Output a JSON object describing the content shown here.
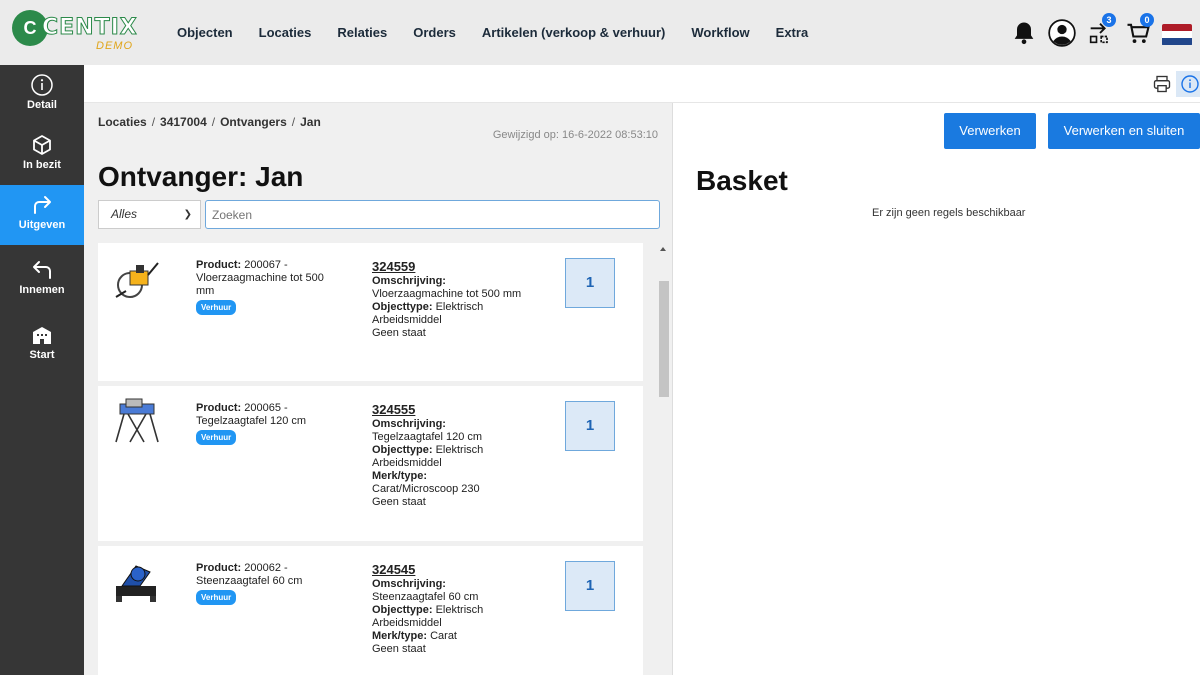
{
  "brand": {
    "name": "CENTIX",
    "sub": "DEMO"
  },
  "nav": [
    "Objecten",
    "Locaties",
    "Relaties",
    "Orders",
    "Artikelen (verkoop & verhuur)",
    "Workflow",
    "Extra"
  ],
  "badges": {
    "transfer": "3",
    "cart": "0"
  },
  "sidebar": [
    {
      "label": "Detail",
      "icon": "info-icon",
      "active": false
    },
    {
      "label": "In bezit",
      "icon": "cube-icon",
      "active": false
    },
    {
      "label": "Uitgeven",
      "icon": "arrow-out-icon",
      "active": true
    },
    {
      "label": "Innemen",
      "icon": "arrow-back-icon",
      "active": false
    },
    {
      "label": "Start",
      "icon": "building-icon",
      "active": false
    }
  ],
  "breadcrumb": [
    "Locaties",
    "3417004",
    "Ontvangers",
    "Jan"
  ],
  "modified": "Gewijzigd op: 16-6-2022 08:53:10",
  "title": "Ontvanger: Jan",
  "filter": {
    "selected": "Alles",
    "search_placeholder": "Zoeken"
  },
  "items": [
    {
      "product_label": "Product:",
      "product": "200067 - Vloerzaagmachine tot 500 mm",
      "tag": "Verhuur",
      "code": "324559",
      "lines": [
        {
          "k": "Omschrijving:",
          "v": "Vloerzaagmachine tot 500 mm",
          "newline": true
        },
        {
          "k": "Objecttype:",
          "v": "Elektrisch Arbeidsmiddel",
          "newline": false
        },
        {
          "k": "",
          "v": "Geen staat",
          "newline": true
        }
      ],
      "qty": "1"
    },
    {
      "product_label": "Product:",
      "product": "200065 - Tegelzaagtafel 120 cm",
      "tag": "Verhuur",
      "code": "324555",
      "lines": [
        {
          "k": "Omschrijving:",
          "v": "Tegelzaagtafel 120 cm",
          "newline": true
        },
        {
          "k": "Objecttype:",
          "v": "Elektrisch Arbeidsmiddel",
          "newline": false
        },
        {
          "k": "Merk/type:",
          "v": "Carat/Microscoop 230",
          "newline": true
        },
        {
          "k": "",
          "v": "Geen staat",
          "newline": true
        }
      ],
      "qty": "1"
    },
    {
      "product_label": "Product:",
      "product": "200062 - Steenzaagtafel 60 cm",
      "tag": "Verhuur",
      "code": "324545",
      "lines": [
        {
          "k": "Omschrijving:",
          "v": "Steenzaagtafel 60 cm",
          "newline": true
        },
        {
          "k": "Objecttype:",
          "v": "Elektrisch Arbeidsmiddel",
          "newline": false
        },
        {
          "k": "Merk/type:",
          "v": "Carat",
          "newline": false
        },
        {
          "k": "",
          "v": "Geen staat",
          "newline": true
        }
      ],
      "qty": "1"
    }
  ],
  "basket": {
    "process_label": "Verwerken",
    "process_close_label": "Verwerken en sluiten",
    "title": "Basket",
    "empty": "Er zijn geen regels beschikbaar"
  },
  "colors": {
    "accent": "#2196f3",
    "sidebar": "#363636",
    "topbar": "#ebebeb"
  }
}
